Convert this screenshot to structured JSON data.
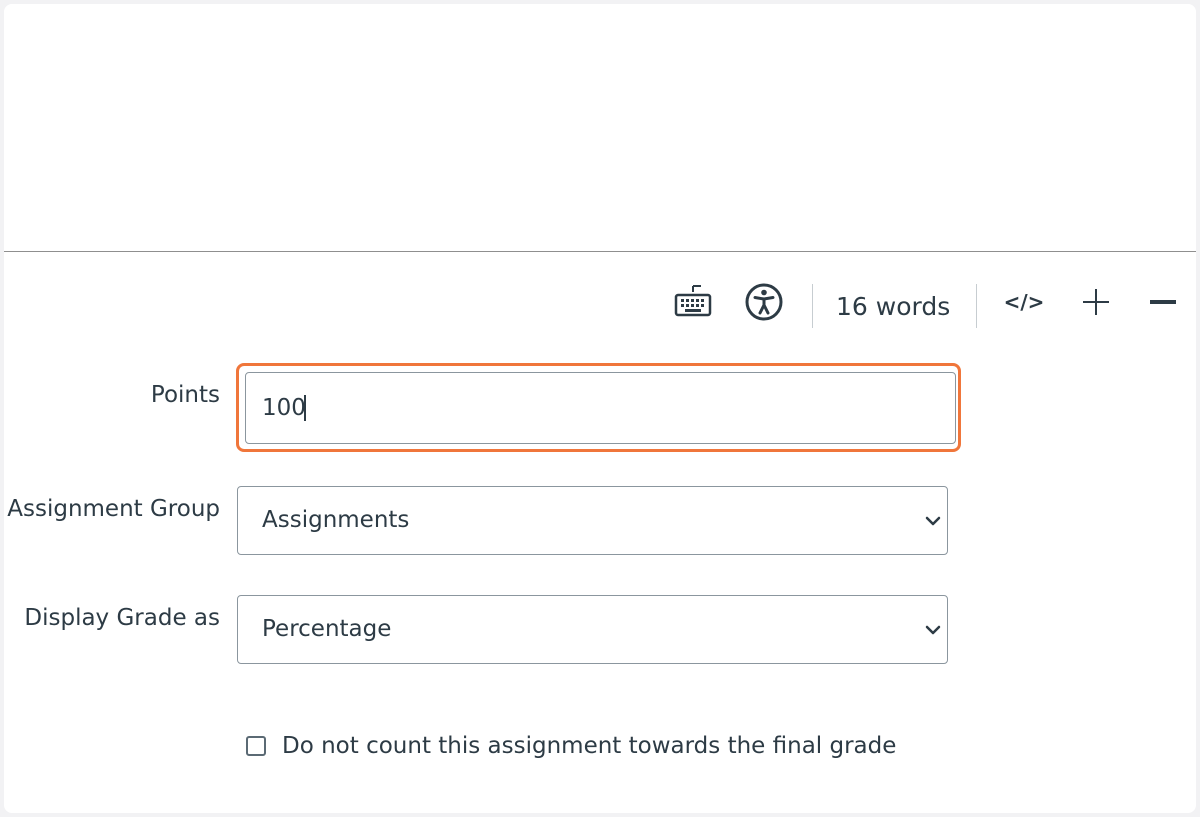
{
  "editor": {
    "statusbar": {
      "keyboard_icon": "keyboard-icon",
      "accessibility_icon": "accessibility-icon",
      "word_count": "16 words",
      "html_toggle_label": "</>",
      "zoom_in_icon": "plus-icon",
      "zoom_out_icon": "minus-icon"
    }
  },
  "form": {
    "points": {
      "label": "Points",
      "value": "100"
    },
    "assignment_group": {
      "label": "Assignment Group",
      "selected": "Assignments"
    },
    "display_grade": {
      "label": "Display Grade as",
      "selected": "Percentage"
    },
    "omit_from_final": {
      "label": "Do not count this assignment towards the final grade",
      "checked": false
    }
  },
  "colors": {
    "focus_ring": "#f0763b",
    "text": "#2d3b45",
    "border": "#8b969e"
  }
}
